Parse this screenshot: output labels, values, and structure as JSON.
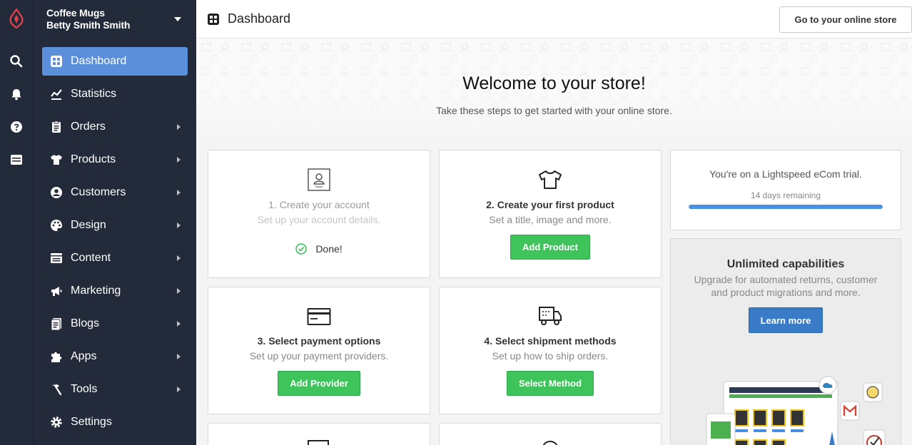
{
  "colors": {
    "sidebar": "#232a3a",
    "active": "#5b8fd9",
    "green": "#3fc45c",
    "blue": "#3a7bc8",
    "brand": "#e3424b"
  },
  "rail": {
    "icons": [
      "lightspeed-logo",
      "search-icon",
      "bell-icon",
      "help-icon",
      "billing-icon"
    ]
  },
  "store": {
    "name": "Coffee Mugs",
    "user": "Betty Smith Smith"
  },
  "nav": [
    {
      "label": "Dashboard",
      "icon": "dashboard-icon",
      "active": true,
      "arrow": false
    },
    {
      "label": "Statistics",
      "icon": "statistics-icon",
      "active": false,
      "arrow": false
    },
    {
      "label": "Orders",
      "icon": "orders-icon",
      "active": false,
      "arrow": true
    },
    {
      "label": "Products",
      "icon": "tshirt-icon",
      "active": false,
      "arrow": true
    },
    {
      "label": "Customers",
      "icon": "customer-icon",
      "active": false,
      "arrow": true
    },
    {
      "label": "Design",
      "icon": "palette-icon",
      "active": false,
      "arrow": true
    },
    {
      "label": "Content",
      "icon": "content-icon",
      "active": false,
      "arrow": true
    },
    {
      "label": "Marketing",
      "icon": "megaphone-icon",
      "active": false,
      "arrow": true
    },
    {
      "label": "Blogs",
      "icon": "blog-icon",
      "active": false,
      "arrow": true
    },
    {
      "label": "Apps",
      "icon": "apps-icon",
      "active": false,
      "arrow": true
    },
    {
      "label": "Tools",
      "icon": "hammer-icon",
      "active": false,
      "arrow": true
    },
    {
      "label": "Settings",
      "icon": "gear-icon",
      "active": false,
      "arrow": false
    }
  ],
  "header": {
    "title": "Dashboard",
    "store_button": "Go to your online store"
  },
  "welcome": {
    "title": "Welcome to your store!",
    "subtitle": "Take these steps to get started with your online store."
  },
  "steps": [
    {
      "title": "1. Create your account",
      "desc": "Set up your account details.",
      "done_label": "Done!"
    },
    {
      "title": "2. Create your first product",
      "desc": "Set a title, image and more.",
      "button": "Add Product"
    },
    {
      "title": "3. Select payment options",
      "desc": "Set up your payment providers.",
      "button": "Add Provider"
    },
    {
      "title": "4. Select shipment methods",
      "desc": "Set up how to ship orders.",
      "button": "Select Method"
    }
  ],
  "trial": {
    "text": "You're on a Lightspeed eCom trial.",
    "days": "14 days remaining",
    "progress": 1.0
  },
  "upgrade": {
    "title": "Unlimited capabilities",
    "desc": "Upgrade for automated returns, customer and product migrations and more.",
    "button": "Learn more"
  }
}
